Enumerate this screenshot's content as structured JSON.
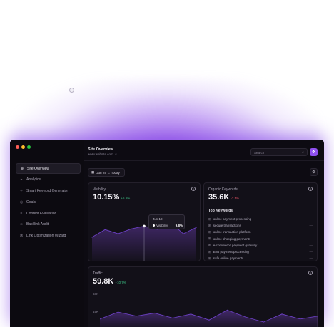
{
  "colors": {
    "accent": "#8f50ee",
    "positive": "#3fc98a",
    "negative": "#e85567"
  },
  "sidebar": {
    "window_controls": [
      {
        "name": "close",
        "color": "#ff5f57"
      },
      {
        "name": "minimize",
        "color": "#febc2e"
      },
      {
        "name": "maximize",
        "color": "#28c840"
      }
    ],
    "items": [
      {
        "label": "Site Overview",
        "icon": "globe-icon",
        "glyph": "⊕",
        "active": true
      },
      {
        "label": "Analytics",
        "icon": "chart-icon",
        "glyph": "⌁",
        "active": false
      },
      {
        "label": "Smart Keyword Generator",
        "icon": "sparkle-icon",
        "glyph": "✧",
        "active": false
      },
      {
        "label": "Goals",
        "icon": "target-icon",
        "glyph": "◎",
        "active": false
      },
      {
        "label": "Content Evaluation",
        "icon": "document-icon",
        "glyph": "≡",
        "active": false
      },
      {
        "label": "Backlink Audit",
        "icon": "link-icon",
        "glyph": "∞",
        "active": false
      },
      {
        "label": "Link Optimization Wizard",
        "icon": "wand-icon",
        "glyph": "⌘",
        "active": false
      }
    ]
  },
  "header": {
    "title": "Site Overview",
    "url": "www.website.com",
    "url_icon": "external-link-icon",
    "search_placeholder": "Search"
  },
  "toolbar": {
    "date_range": "Jun 24 → Today"
  },
  "visibility_card": {
    "label": "Visibility",
    "value": "10.15%",
    "delta": "+5.6%",
    "tooltip": {
      "date": "Jun 18",
      "series": "Visibility",
      "value": "9.8%"
    }
  },
  "keywords_card": {
    "label": "Organic Keywords",
    "value": "35.6K",
    "delta": "-2.5%",
    "top_title": "Top Keywords",
    "keywords": [
      "online payment processing",
      "secure transactions",
      "online transaction platform",
      "online shopping payments",
      "e-commerce payment gateway",
      "B2B payment processing",
      "safe online payments"
    ],
    "placeholder": "—"
  },
  "traffic_card": {
    "label": "Traffic",
    "value": "59.8K",
    "delta": "+10.7%",
    "y_ticks": [
      "68K",
      "45K"
    ]
  },
  "chart_data": [
    {
      "type": "area",
      "title": "Visibility",
      "x": [
        0,
        1,
        2,
        3,
        4,
        5,
        6,
        7,
        8
      ],
      "values": [
        6.6,
        8.8,
        7.6,
        9.0,
        9.8,
        8.9,
        11.0,
        7.6,
        9.4
      ],
      "ylim": [
        0,
        14
      ],
      "grid": false
    },
    {
      "type": "area",
      "title": "Traffic",
      "x": [
        0,
        1,
        2,
        3,
        4,
        5,
        6,
        7,
        8,
        9,
        10,
        11,
        12
      ],
      "values": [
        41,
        48,
        44,
        47,
        42,
        46,
        40,
        50,
        43,
        38,
        46,
        41,
        44
      ],
      "ylim": [
        30,
        72
      ],
      "y_ticks": [
        68,
        45
      ],
      "grid": false
    }
  ]
}
